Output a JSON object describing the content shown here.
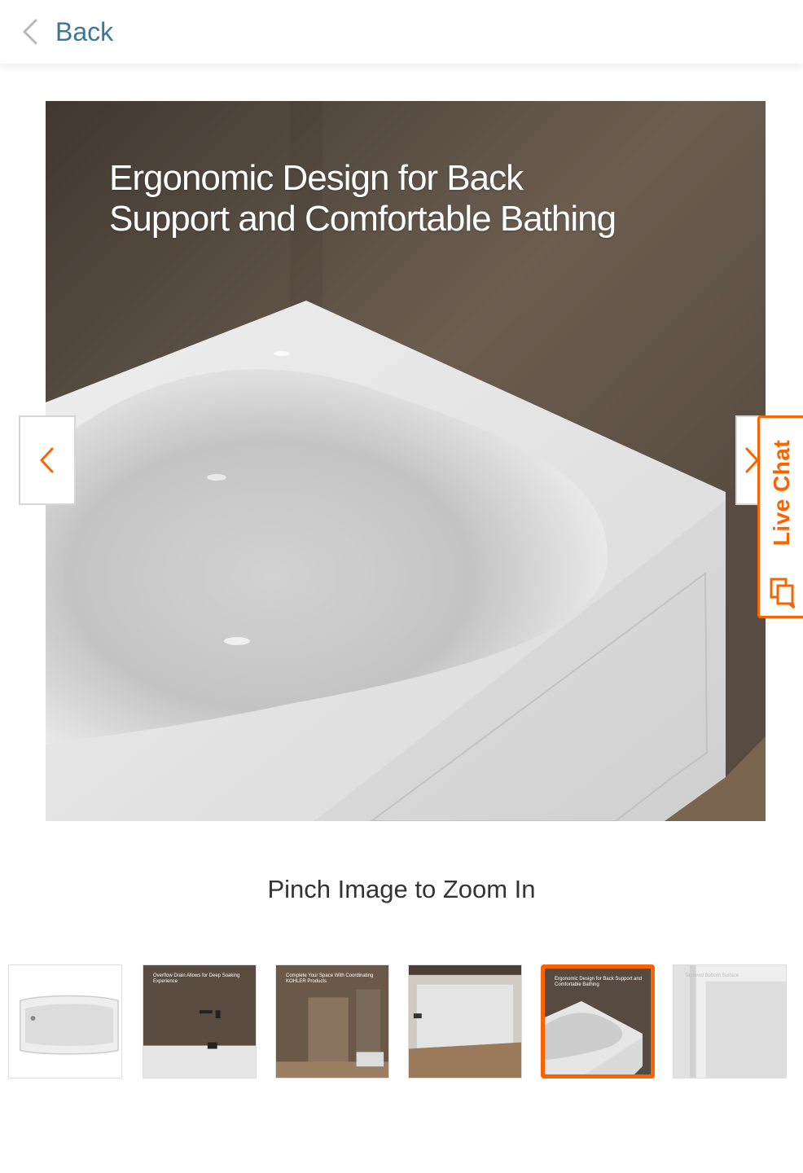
{
  "header": {
    "back_label": "Back"
  },
  "gallery": {
    "main_caption_line1": "Ergonomic Design for Back",
    "main_caption_line2": "Support and Comfortable Bathing",
    "zoom_hint": "Pinch Image to Zoom In",
    "selected_index": 4,
    "thumbnails": [
      {
        "caption": ""
      },
      {
        "caption": "Overflow Drain Allows for Deep Soaking Experience"
      },
      {
        "caption": "Complete Your Space With Coordinating KOHLER Products"
      },
      {
        "caption": ""
      },
      {
        "caption": "Ergonomic Design for Back Support and Comfortable Bathing"
      },
      {
        "caption": "Textured Bottom Surface"
      }
    ]
  },
  "live_chat": {
    "label": "Live Chat"
  },
  "colors": {
    "accent": "#f96302",
    "link": "#3e7697",
    "text": "#333333"
  },
  "icons": [
    "chevron-left-icon",
    "chevron-right-icon",
    "chat-icon"
  ]
}
